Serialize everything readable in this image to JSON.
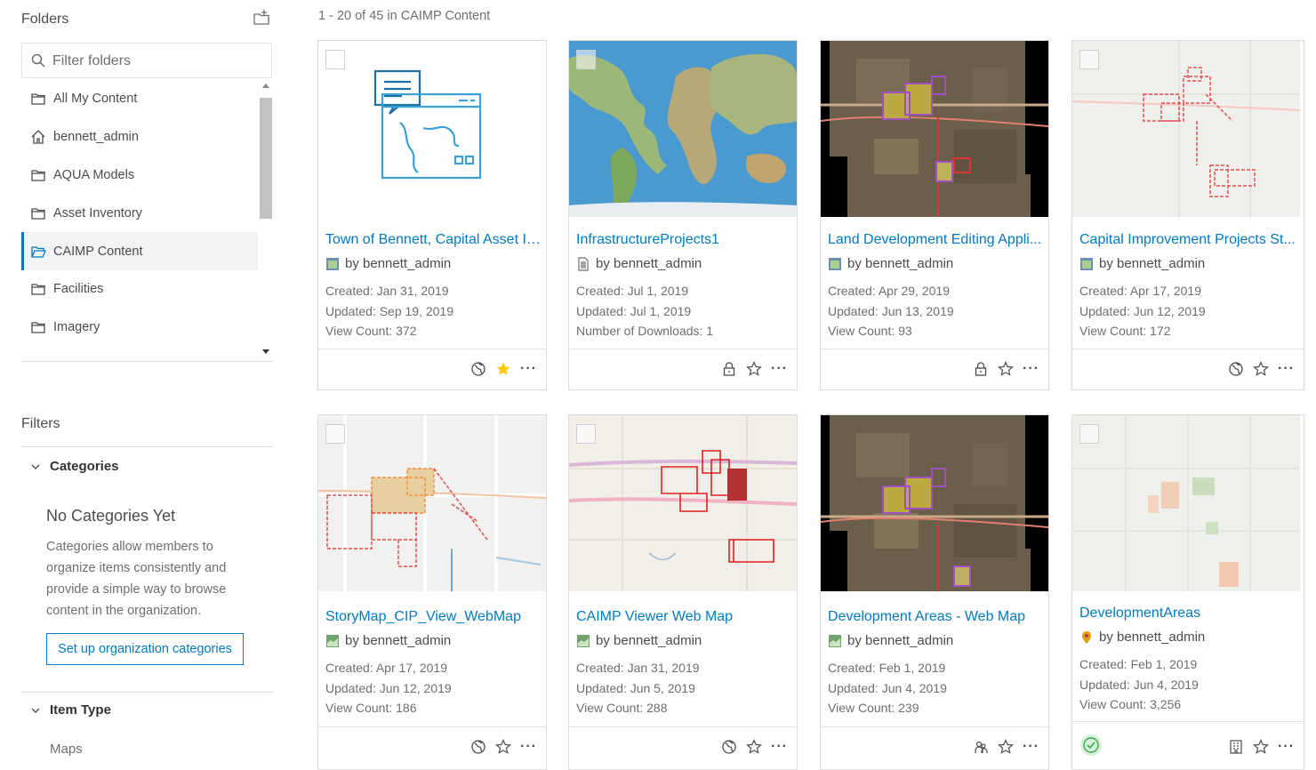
{
  "sidebar": {
    "folders_title": "Folders",
    "filter_placeholder": "Filter folders",
    "folders": [
      {
        "label": "All My Content",
        "icon": "folder-icon"
      },
      {
        "label": "bennett_admin",
        "icon": "home-icon"
      },
      {
        "label": "AQUA Models",
        "icon": "folder-icon"
      },
      {
        "label": "Asset Inventory",
        "icon": "folder-icon"
      },
      {
        "label": "CAIMP Content",
        "icon": "folder-open-icon",
        "active": true
      },
      {
        "label": "Facilities",
        "icon": "folder-icon"
      },
      {
        "label": "Imagery",
        "icon": "folder-icon"
      }
    ],
    "filters_title": "Filters",
    "categories": {
      "heading": "Categories",
      "empty_title": "No Categories Yet",
      "empty_desc": "Categories allow members to organize items consistently and provide a simple way to browse content in the organization.",
      "setup_button": "Set up organization categories"
    },
    "item_type": {
      "heading": "Item Type",
      "first_option": "Maps"
    }
  },
  "results": {
    "count_text": "1 - 20 of 45 in CAIMP Content"
  },
  "items": [
    {
      "title": "Town of Bennett, Capital Asset In...",
      "owner": "by bennett_admin",
      "type_icon": "app-icon",
      "line1": "Created: Jan 31, 2019",
      "line2": "Updated: Sep 19, 2019",
      "line3": "View Count: 372",
      "thumb": "app-illustration",
      "share_icon": "globe-icon",
      "favorite": true
    },
    {
      "title": "InfrastructureProjects1",
      "owner": "by bennett_admin",
      "type_icon": "document-icon",
      "line1": "Created: Jul 1, 2019",
      "line2": "Updated: Jul 1, 2019",
      "line3": "Number of Downloads: 1",
      "thumb": "world-map",
      "share_icon": "lock-icon",
      "favorite": false
    },
    {
      "title": "Land Development Editing Appli...",
      "owner": "by bennett_admin",
      "type_icon": "app-icon",
      "line1": "Created: Apr 29, 2019",
      "line2": "Updated: Jun 13, 2019",
      "line3": "View Count: 93",
      "thumb": "imagery",
      "share_icon": "lock-icon",
      "favorite": false
    },
    {
      "title": "Capital Improvement Projects St...",
      "owner": "by bennett_admin",
      "type_icon": "app-icon",
      "line1": "Created: Apr 17, 2019",
      "line2": "Updated: Jun 12, 2019",
      "line3": "View Count: 172",
      "thumb": "light-map",
      "share_icon": "globe-icon",
      "favorite": false
    },
    {
      "title": "StoryMap_CIP_View_WebMap",
      "owner": "by bennett_admin",
      "type_icon": "webmap-icon",
      "line1": "Created: Apr 17, 2019",
      "line2": "Updated: Jun 12, 2019",
      "line3": "View Count: 186",
      "thumb": "street-map",
      "share_icon": "globe-icon",
      "favorite": false
    },
    {
      "title": "CAIMP Viewer Web Map",
      "owner": "by bennett_admin",
      "type_icon": "webmap-icon",
      "line1": "Created: Jan 31, 2019",
      "line2": "Updated: Jun 5, 2019",
      "line3": "View Count: 288",
      "thumb": "topo-map",
      "share_icon": "globe-icon",
      "favorite": false
    },
    {
      "title": "Development Areas - Web Map",
      "owner": "by bennett_admin",
      "type_icon": "webmap-icon",
      "line1": "Created: Feb 1, 2019",
      "line2": "Updated: Jun 4, 2019",
      "line3": "View Count: 239",
      "thumb": "imagery",
      "share_icon": "group-icon",
      "favorite": false
    },
    {
      "title": "DevelopmentAreas",
      "owner": "by bennett_admin",
      "type_icon": "feature-layer-icon",
      "line1": "Created: Feb 1, 2019",
      "line2": "Updated: Jun 4, 2019",
      "line3": "View Count: 3,256",
      "thumb": "faded-map",
      "share_icon": "organization-icon",
      "favorite": false,
      "authoritative": true
    }
  ],
  "colors": {
    "accent": "#007ac2",
    "favorite": "#ffc900",
    "authoritative": "#35ac46"
  }
}
